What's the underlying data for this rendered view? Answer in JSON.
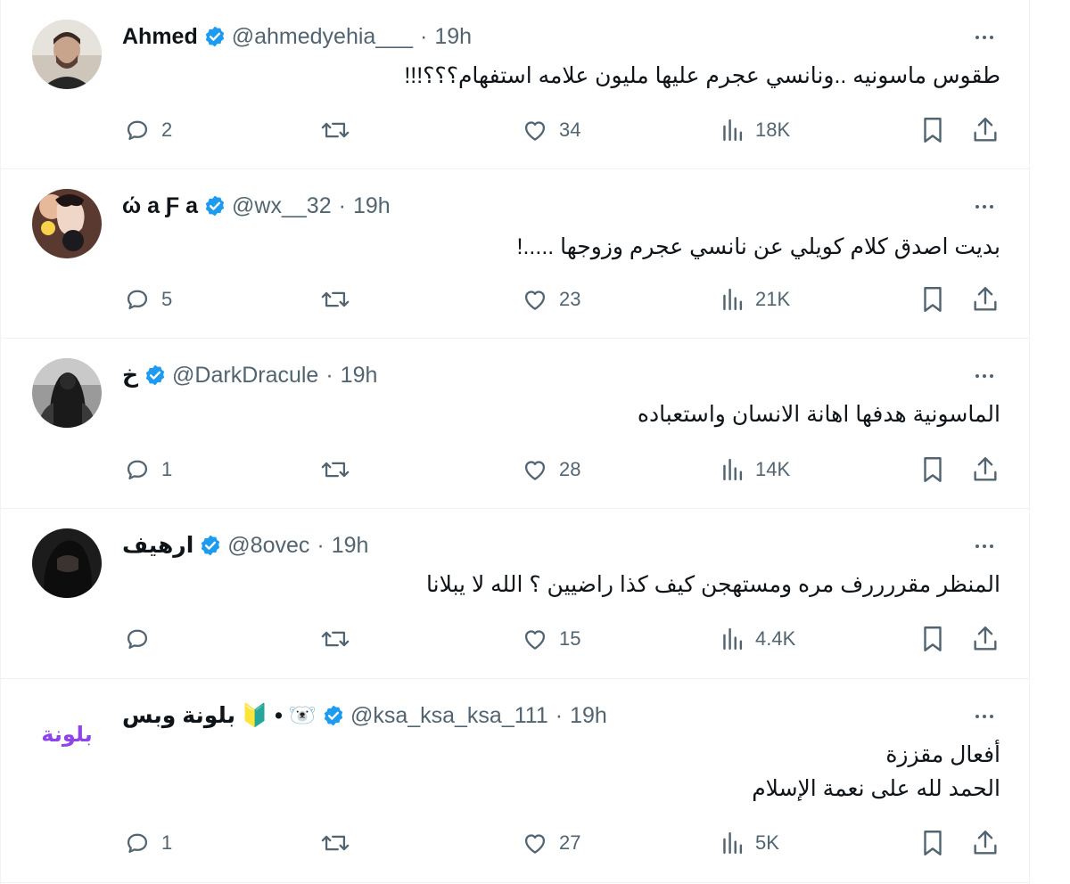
{
  "colors": {
    "verified": "#1d9bf0",
    "secondary_text": "#536471",
    "primary_text": "#0f1419",
    "divider": "#eff3f4"
  },
  "tweets": [
    {
      "name": "Ahmed",
      "handle": "@ahmedyehia___",
      "separator": "·",
      "time": "19h",
      "text": [
        "طقوس ماسونيه ..ونانسي عجرم عليها مليون علامه استفهام؟؟؟!!!"
      ],
      "replies": "2",
      "reposts": "",
      "likes": "34",
      "views": "18K",
      "avatar_icon": "man-portrait-avatar"
    },
    {
      "name": "ώ a Ƒ a",
      "handle": "@wx__32",
      "separator": "·",
      "time": "19h",
      "text": [
        "بديت اصدق كلام كويلي عن نانسي عجرم وزوجها .....!"
      ],
      "replies": "5",
      "reposts": "",
      "likes": "23",
      "views": "21K",
      "avatar_icon": "anime-character-avatar"
    },
    {
      "name": "خ",
      "handle": "@DarkDracule",
      "separator": "·",
      "time": "19h",
      "text": [
        "الماسونية هدفها اهانة الانسان واستعباده"
      ],
      "replies": "1",
      "reposts": "",
      "likes": "28",
      "views": "14K",
      "avatar_icon": "dark-figure-avatar"
    },
    {
      "name": "ارهيف",
      "handle": "@8ovec",
      "separator": "·",
      "time": "19h",
      "text": [
        "المنظر مقررررف مره ومستهجن كيف كذا راضيين ؟ الله لا يبلانا"
      ],
      "replies": "",
      "reposts": "",
      "likes": "15",
      "views": "4.4K",
      "avatar_icon": "veiled-figure-avatar"
    },
    {
      "name": "بلونة وبس",
      "name_emoji": "🔰 • 🐻‍❄️",
      "handle": "@ksa_ksa_ksa_111",
      "separator": "·",
      "time": "19h",
      "text": [
        "أفعال مقززة",
        "الحمد لله على نعمة الإسلام"
      ],
      "replies": "1",
      "reposts": "",
      "likes": "27",
      "views": "5K",
      "avatar_text": "بلونة",
      "avatar_icon": "text-logo-avatar"
    }
  ]
}
